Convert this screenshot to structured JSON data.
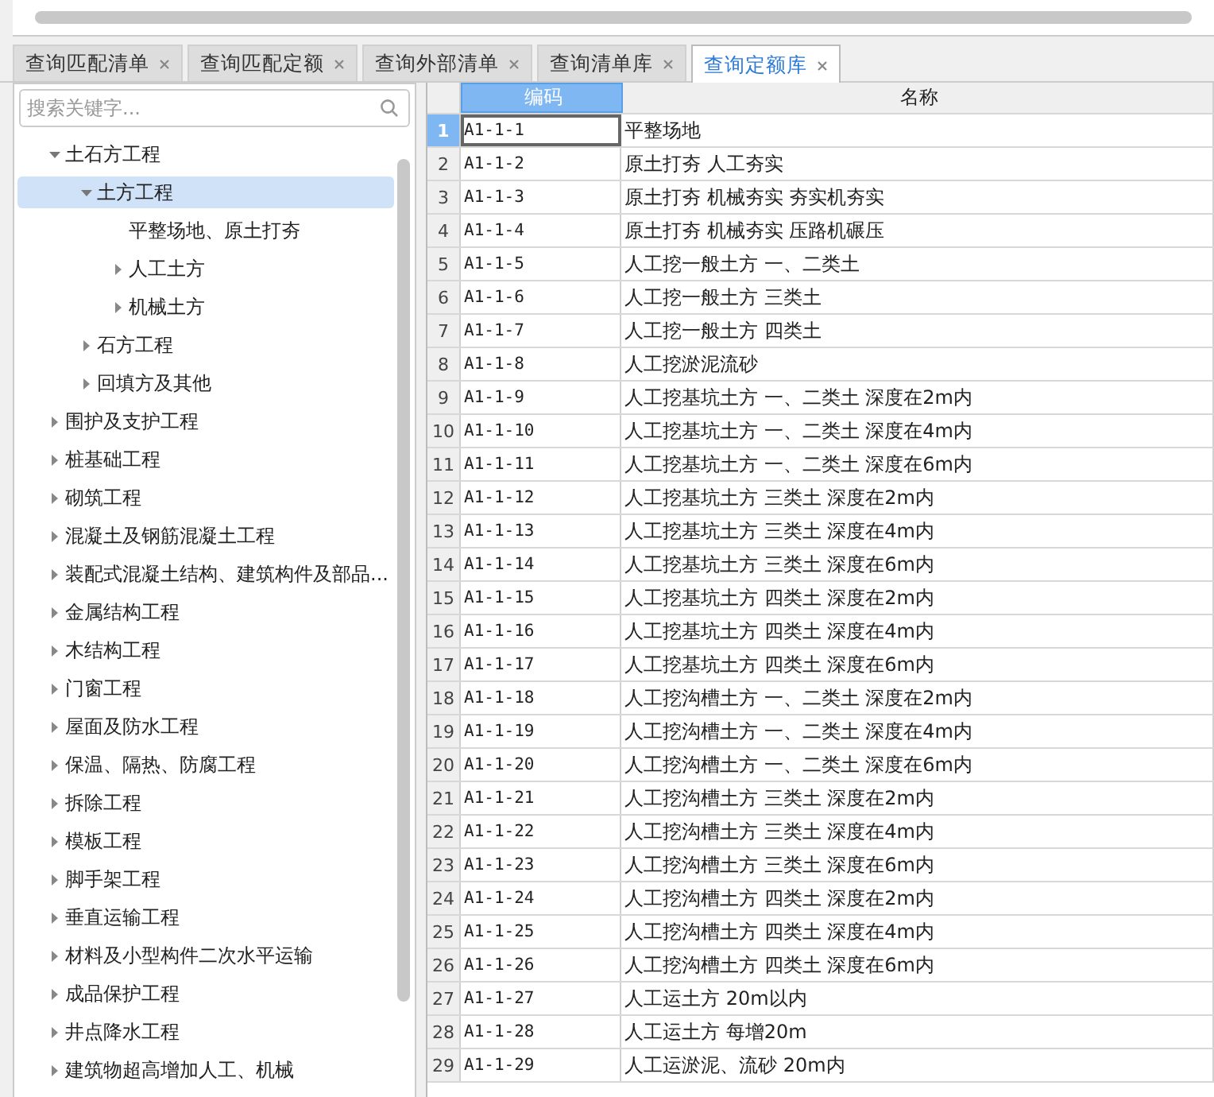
{
  "tabs": [
    {
      "label": "查询匹配清单",
      "selected": false
    },
    {
      "label": "查询匹配定额",
      "selected": false
    },
    {
      "label": "查询外部清单",
      "selected": false
    },
    {
      "label": "查询清单库",
      "selected": false
    },
    {
      "label": "查询定额库",
      "selected": true
    }
  ],
  "search": {
    "placeholder": "搜索关键字..."
  },
  "tree": [
    {
      "label": "土石方工程",
      "expanded": true,
      "selected": false,
      "children": [
        {
          "label": "土方工程",
          "expanded": true,
          "selected": true,
          "children": [
            {
              "label": "平整场地、原土打夯",
              "selected": false
            },
            {
              "label": "人工土方",
              "expanded": false,
              "selected": false
            },
            {
              "label": "机械土方",
              "expanded": false,
              "selected": false
            }
          ]
        },
        {
          "label": "石方工程",
          "expanded": false,
          "selected": false
        },
        {
          "label": "回填方及其他",
          "expanded": false,
          "selected": false
        }
      ]
    },
    {
      "label": "围护及支护工程",
      "expanded": false,
      "selected": false
    },
    {
      "label": "桩基础工程",
      "expanded": false,
      "selected": false
    },
    {
      "label": "砌筑工程",
      "expanded": false,
      "selected": false
    },
    {
      "label": "混凝土及钢筋混凝土工程",
      "expanded": false,
      "selected": false
    },
    {
      "label": "装配式混凝土结构、建筑构件及部品...",
      "expanded": false,
      "selected": false
    },
    {
      "label": "金属结构工程",
      "expanded": false,
      "selected": false
    },
    {
      "label": "木结构工程",
      "expanded": false,
      "selected": false
    },
    {
      "label": "门窗工程",
      "expanded": false,
      "selected": false
    },
    {
      "label": "屋面及防水工程",
      "expanded": false,
      "selected": false
    },
    {
      "label": "保温、隔热、防腐工程",
      "expanded": false,
      "selected": false
    },
    {
      "label": "拆除工程",
      "expanded": false,
      "selected": false
    },
    {
      "label": "模板工程",
      "expanded": false,
      "selected": false
    },
    {
      "label": "脚手架工程",
      "expanded": false,
      "selected": false
    },
    {
      "label": "垂直运输工程",
      "expanded": false,
      "selected": false
    },
    {
      "label": "材料及小型构件二次水平运输",
      "expanded": false,
      "selected": false
    },
    {
      "label": "成品保护工程",
      "expanded": false,
      "selected": false
    },
    {
      "label": "井点降水工程",
      "expanded": false,
      "selected": false
    },
    {
      "label": "建筑物超高增加人工、机械",
      "expanded": false,
      "selected": false
    }
  ],
  "table": {
    "columns": [
      {
        "label": "编码",
        "selected": true
      },
      {
        "label": "名称",
        "selected": false
      }
    ],
    "rows": [
      {
        "index": "1",
        "code": "A1-1-1",
        "name": "平整场地",
        "selected": true
      },
      {
        "index": "2",
        "code": "A1-1-2",
        "name": "原土打夯 人工夯实",
        "selected": false
      },
      {
        "index": "3",
        "code": "A1-1-3",
        "name": "原土打夯 机械夯实 夯实机夯实",
        "selected": false
      },
      {
        "index": "4",
        "code": "A1-1-4",
        "name": "原土打夯 机械夯实 压路机碾压",
        "selected": false
      },
      {
        "index": "5",
        "code": "A1-1-5",
        "name": "人工挖一般土方 一、二类土",
        "selected": false
      },
      {
        "index": "6",
        "code": "A1-1-6",
        "name": "人工挖一般土方 三类土",
        "selected": false
      },
      {
        "index": "7",
        "code": "A1-1-7",
        "name": "人工挖一般土方 四类土",
        "selected": false
      },
      {
        "index": "8",
        "code": "A1-1-8",
        "name": "人工挖淤泥流砂",
        "selected": false
      },
      {
        "index": "9",
        "code": "A1-1-9",
        "name": "人工挖基坑土方 一、二类土 深度在2m内",
        "selected": false
      },
      {
        "index": "10",
        "code": "A1-1-10",
        "name": "人工挖基坑土方 一、二类土 深度在4m内",
        "selected": false
      },
      {
        "index": "11",
        "code": "A1-1-11",
        "name": "人工挖基坑土方 一、二类土 深度在6m内",
        "selected": false
      },
      {
        "index": "12",
        "code": "A1-1-12",
        "name": "人工挖基坑土方 三类土 深度在2m内",
        "selected": false
      },
      {
        "index": "13",
        "code": "A1-1-13",
        "name": "人工挖基坑土方 三类土 深度在4m内",
        "selected": false
      },
      {
        "index": "14",
        "code": "A1-1-14",
        "name": "人工挖基坑土方 三类土 深度在6m内",
        "selected": false
      },
      {
        "index": "15",
        "code": "A1-1-15",
        "name": "人工挖基坑土方 四类土 深度在2m内",
        "selected": false
      },
      {
        "index": "16",
        "code": "A1-1-16",
        "name": "人工挖基坑土方 四类土 深度在4m内",
        "selected": false
      },
      {
        "index": "17",
        "code": "A1-1-17",
        "name": "人工挖基坑土方 四类土 深度在6m内",
        "selected": false
      },
      {
        "index": "18",
        "code": "A1-1-18",
        "name": "人工挖沟槽土方 一、二类土 深度在2m内",
        "selected": false
      },
      {
        "index": "19",
        "code": "A1-1-19",
        "name": "人工挖沟槽土方 一、二类土 深度在4m内",
        "selected": false
      },
      {
        "index": "20",
        "code": "A1-1-20",
        "name": "人工挖沟槽土方 一、二类土 深度在6m内",
        "selected": false
      },
      {
        "index": "21",
        "code": "A1-1-21",
        "name": "人工挖沟槽土方 三类土 深度在2m内",
        "selected": false
      },
      {
        "index": "22",
        "code": "A1-1-22",
        "name": "人工挖沟槽土方 三类土 深度在4m内",
        "selected": false
      },
      {
        "index": "23",
        "code": "A1-1-23",
        "name": "人工挖沟槽土方 三类土 深度在6m内",
        "selected": false
      },
      {
        "index": "24",
        "code": "A1-1-24",
        "name": "人工挖沟槽土方 四类土 深度在2m内",
        "selected": false
      },
      {
        "index": "25",
        "code": "A1-1-25",
        "name": "人工挖沟槽土方 四类土 深度在4m内",
        "selected": false
      },
      {
        "index": "26",
        "code": "A1-1-26",
        "name": "人工挖沟槽土方 四类土 深度在6m内",
        "selected": false
      },
      {
        "index": "27",
        "code": "A1-1-27",
        "name": "人工运土方 20m以内",
        "selected": false
      },
      {
        "index": "28",
        "code": "A1-1-28",
        "name": "人工运土方 每增20m",
        "selected": false
      },
      {
        "index": "29",
        "code": "A1-1-29",
        "name": "人工运淤泥、流砂 20m内",
        "selected": false
      }
    ]
  }
}
